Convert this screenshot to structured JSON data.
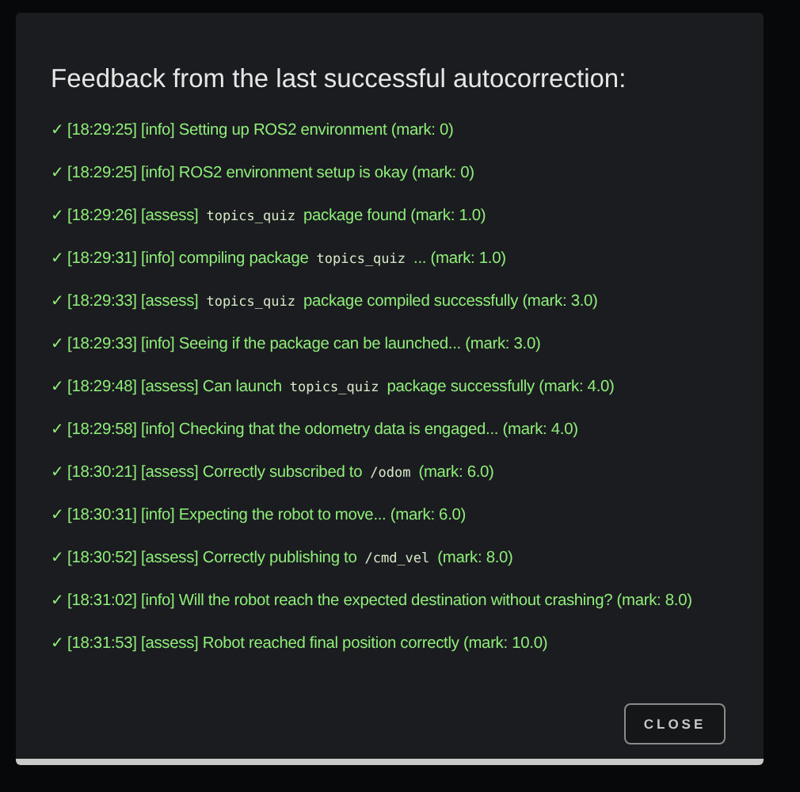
{
  "dialog": {
    "title": "Feedback from the last successful autocorrection:",
    "lines": [
      {
        "parts": [
          {
            "kind": "text",
            "text": "✓ [18:29:25] [info] Setting up ROS2 environment (mark: 0)"
          }
        ]
      },
      {
        "parts": [
          {
            "kind": "text",
            "text": "✓ [18:29:25] [info] ROS2 environment setup is okay (mark: 0)"
          }
        ]
      },
      {
        "parts": [
          {
            "kind": "text",
            "text": "✓ [18:29:26] [assess]"
          },
          {
            "kind": "code",
            "text": "topics_quiz"
          },
          {
            "kind": "text",
            "text": "package found (mark: 1.0)"
          }
        ]
      },
      {
        "parts": [
          {
            "kind": "text",
            "text": "✓ [18:29:31] [info] compiling package"
          },
          {
            "kind": "code",
            "text": "topics_quiz"
          },
          {
            "kind": "text",
            "text": "... (mark: 1.0)"
          }
        ]
      },
      {
        "parts": [
          {
            "kind": "text",
            "text": "✓ [18:29:33] [assess]"
          },
          {
            "kind": "code",
            "text": "topics_quiz"
          },
          {
            "kind": "text",
            "text": "package compiled successfully (mark: 3.0)"
          }
        ]
      },
      {
        "parts": [
          {
            "kind": "text",
            "text": "✓ [18:29:33] [info] Seeing if the package can be launched... (mark: 3.0)"
          }
        ]
      },
      {
        "parts": [
          {
            "kind": "text",
            "text": "✓ [18:29:48] [assess] Can launch"
          },
          {
            "kind": "code",
            "text": "topics_quiz"
          },
          {
            "kind": "text",
            "text": "package successfully (mark: 4.0)"
          }
        ]
      },
      {
        "parts": [
          {
            "kind": "text",
            "text": "✓ [18:29:58] [info] Checking that the odometry data is engaged... (mark: 4.0)"
          }
        ]
      },
      {
        "parts": [
          {
            "kind": "text",
            "text": "✓ [18:30:21] [assess] Correctly subscribed to"
          },
          {
            "kind": "code",
            "text": "/odom"
          },
          {
            "kind": "text",
            "text": "(mark: 6.0)"
          }
        ]
      },
      {
        "parts": [
          {
            "kind": "text",
            "text": "✓ [18:30:31] [info] Expecting the robot to move... (mark: 6.0)"
          }
        ]
      },
      {
        "parts": [
          {
            "kind": "text",
            "text": "✓ [18:30:52] [assess] Correctly publishing to"
          },
          {
            "kind": "code",
            "text": "/cmd_vel"
          },
          {
            "kind": "text",
            "text": "(mark: 8.0)"
          }
        ]
      },
      {
        "parts": [
          {
            "kind": "text",
            "text": "✓ [18:31:02] [info] Will the robot reach the expected destination without crashing? (mark: 8.0)"
          }
        ]
      },
      {
        "parts": [
          {
            "kind": "text",
            "text": "✓ [18:31:53] [assess] Robot reached final position correctly (mark: 10.0)"
          }
        ]
      }
    ],
    "close_button": "CLOSE"
  }
}
